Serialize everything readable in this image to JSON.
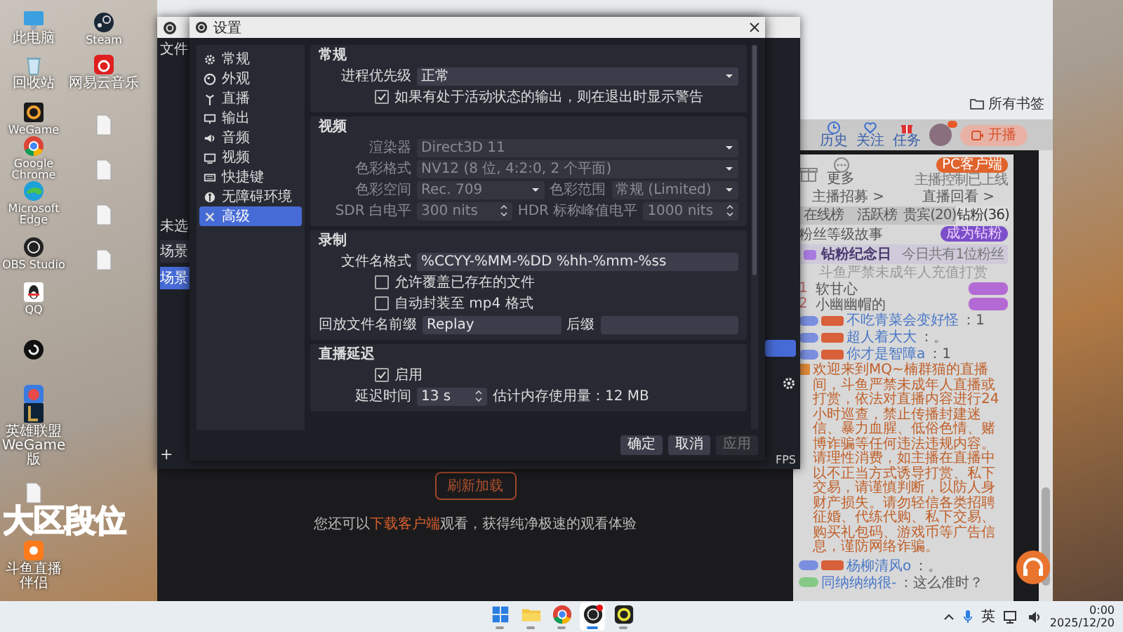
{
  "desktop": {
    "icons": [
      {
        "label": "此电脑",
        "kind": "monitor"
      },
      {
        "label": "回收站",
        "kind": "bin"
      },
      {
        "label": "WeGame",
        "kind": "wegame"
      },
      {
        "label": "Google Chrome",
        "kind": "chrome"
      },
      {
        "label": "Microsoft Edge",
        "kind": "edge"
      },
      {
        "label": "OBS Studio",
        "kind": "obs"
      },
      {
        "label": "QQ",
        "kind": "qq"
      },
      {
        "kind": "ghub"
      },
      {
        "kind": "game"
      },
      {
        "label": "英雄联盟WeGame版",
        "kind": "lol"
      },
      {
        "kind": "file"
      },
      {
        "label": "斗鱼直播伴侣",
        "kind": "douyu"
      },
      {
        "label": "Steam",
        "kind": "steam"
      },
      {
        "label": "网易云音乐",
        "kind": "music"
      },
      {
        "kind": "file"
      },
      {
        "kind": "file"
      },
      {
        "kind": "file"
      },
      {
        "kind": "file"
      }
    ],
    "overlay_text": "大区段位"
  },
  "obs_window": {
    "menu": "文件",
    "scene_hint": "未选",
    "scenes_header": "场景",
    "scenes": [
      {
        "label": "场景",
        "selected": true
      }
    ],
    "add_button": "+",
    "fps": "FPS"
  },
  "settings": {
    "title": "设置",
    "nav": [
      {
        "label": "常规",
        "selected": false
      },
      {
        "label": "外观",
        "selected": false
      },
      {
        "label": "直播",
        "selected": false
      },
      {
        "label": "输出",
        "selected": false
      },
      {
        "label": "音频",
        "selected": false
      },
      {
        "label": "视频",
        "selected": false
      },
      {
        "label": "快捷键",
        "selected": false
      },
      {
        "label": "无障碍环境",
        "selected": false
      },
      {
        "label": "高级",
        "selected": true
      }
    ],
    "sections": [
      {
        "title": "常规",
        "rows": [
          {
            "kind": "select",
            "label": "进程优先级",
            "value": "正常",
            "disabled": false
          },
          {
            "kind": "checkbox",
            "text": "如果有处于活动状态的输出，则在退出时显示警告",
            "checked": true
          }
        ]
      },
      {
        "title": "视频",
        "rows": [
          {
            "kind": "select",
            "label": "渲染器",
            "value": "Direct3D 11",
            "disabled": true
          },
          {
            "kind": "select",
            "label": "色彩格式",
            "value": "NV12 (8 位, 4:2:0, 2 个平面)",
            "disabled": true
          },
          {
            "kind": "select_pair",
            "label": "色彩空间",
            "value": "Rec. 709",
            "label2": "色彩范围",
            "value2": "常规 (Limited)",
            "disabled": true
          },
          {
            "kind": "spin_pair",
            "label": "SDR 白电平",
            "value": "300 nits",
            "label2": "HDR 标称峰值电平",
            "value2": "1000 nits",
            "disabled": true
          }
        ]
      },
      {
        "title": "录制",
        "rows": [
          {
            "kind": "text",
            "label": "文件名格式",
            "value": "%CCYY-%MM-%DD %hh-%mm-%ss",
            "disabled": false
          },
          {
            "kind": "checkbox",
            "text": "允许覆盖已存在的文件",
            "checked": false
          },
          {
            "kind": "checkbox",
            "text": "自动封装至 mp4 格式",
            "checked": false
          },
          {
            "kind": "text_pair",
            "label": "回放文件名前缀",
            "value": "Replay",
            "label2": "后缀",
            "disabled": false
          }
        ]
      },
      {
        "title": "直播延迟",
        "rows": [
          {
            "kind": "checkbox",
            "text": "启用",
            "checked": true
          },
          {
            "kind": "spin_note",
            "label": "延迟时间",
            "value": "13 s",
            "note": "估计内存使用量：12 MB",
            "disabled": false
          }
        ]
      }
    ],
    "buttons": [
      {
        "label": "确定",
        "disabled": false
      },
      {
        "label": "取消",
        "disabled": false
      },
      {
        "label": "应用",
        "disabled": true
      }
    ]
  },
  "browser": {
    "bookmarks": "所有书签",
    "header_links": [
      "历史",
      "关注",
      "任务"
    ],
    "live_button": "开播",
    "refresh_button": "刷新加载",
    "download_hint": {
      "before": "您还可以",
      "link": "下载客户端",
      "after": "观看，获得纯净极速的观看体验"
    },
    "panel": {
      "more": "更多",
      "client_button": "PC客户端",
      "client_note": "主播控制已上线",
      "links": [
        "主播招募 >",
        "直播回看 >"
      ],
      "tabs": [
        {
          "label": "在线榜",
          "selected": false
        },
        {
          "label": "活跃榜",
          "selected": false
        },
        {
          "label": "贵宾(20)",
          "selected": false
        },
        {
          "label": "钻粉(36)",
          "selected": true
        }
      ],
      "fans_story": "粉丝等级故事",
      "join_badge": "成为钻粉",
      "anniversary": "钻粉纪念日",
      "anniversary_note": "今日共有1位粉丝",
      "notice": "斗鱼严禁未成年人充值打赏",
      "ranks": [
        {
          "rank": "1",
          "name": "软甘心"
        },
        {
          "rank": "2",
          "name": "小幽幽帽的"
        }
      ],
      "messages": [
        {
          "kind": "chat",
          "user": "不吃青菜会变好怪",
          "text": "：1",
          "color": "#7b8fe0",
          "medal": true
        },
        {
          "kind": "chat",
          "user": "超人着大大",
          "text": "：。",
          "color": "#7b8fe0",
          "medal": true
        },
        {
          "kind": "chat",
          "user": "你才是智障a",
          "text": "：1",
          "color": "#7b8fe0",
          "medal": true
        },
        {
          "kind": "system",
          "text": "欢迎来到MQ~楠群猫的直播间，斗鱼严禁未成年人直播或打赏，依法对直播内容进行24小时巡查，禁止传播封建迷信、暴力血腥、低俗色情、赌博诈骗等任何违法违规内容。请理性消费，如主播在直播中以不正当方式诱导打赏、私下交易，请谨慎判断，以防人身财产损失。请勿轻信各类招聘征婚、代练代购、私下交易、购买礼包码、游戏币等广告信息，谨防网络诈骗。"
        },
        {
          "kind": "chat",
          "user": "杨柳清风o",
          "text": "：。",
          "color": "#7b8fe0",
          "medal": true
        },
        {
          "kind": "chat",
          "user": "同纳纳纳很-",
          "text": "：这么准时？",
          "color": "#86c986",
          "medal": false
        }
      ]
    }
  },
  "taskbar": {
    "apps": [
      {
        "active": false
      },
      {
        "active": false
      },
      {
        "active": false
      },
      {
        "active": true
      },
      {
        "active": false
      }
    ],
    "ime": "英",
    "time": "0:00",
    "date": "2025/12/20"
  }
}
